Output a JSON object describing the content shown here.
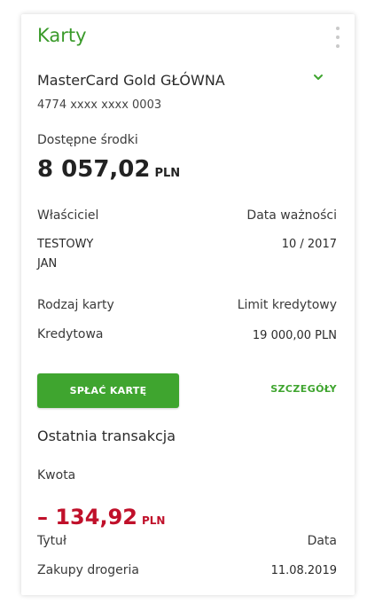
{
  "widget": {
    "title": "Karty",
    "menu_icon": "vertical-dots-icon"
  },
  "card": {
    "name": "MasterCard Gold GŁÓWNA",
    "number": "4774 xxxx xxxx 0003",
    "dropdown_icon": "chevron-down-icon"
  },
  "funds": {
    "label": "Dostępne środki",
    "amount": "8 057,02",
    "currency": "PLN"
  },
  "details": {
    "owner_label": "Właściciel",
    "owner_line1": "TESTOWY",
    "owner_line2": "JAN",
    "expiry_label": "Data ważności",
    "expiry_value": "10 / 2017",
    "type_label": "Rodzaj karty",
    "type_value": "Kredytowa",
    "limit_label": "Limit kredytowy",
    "limit_value": "19 000,00 PLN"
  },
  "actions": {
    "pay_button": "SPŁAĆ KARTĘ",
    "details_link": "SZCZEGÓŁY"
  },
  "last_transaction": {
    "section_title": "Ostatnia transakcja",
    "amount_label": "Kwota",
    "amount": "– 134,92",
    "currency": "PLN",
    "title_label": "Tytuł",
    "title_value": "Zakupy drogeria",
    "date_label": "Data",
    "date_value": "11.08.2019"
  },
  "colors": {
    "accent_green": "#3fa52f",
    "title_green": "#3a9a2a",
    "negative_red": "#c0102a"
  }
}
